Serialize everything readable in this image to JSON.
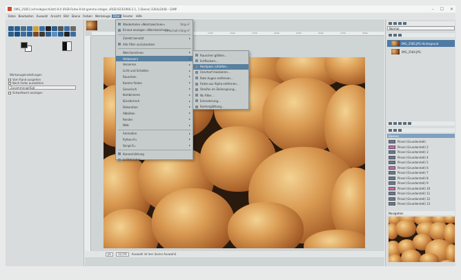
{
  "window": {
    "title": "[IMG_2585] (schreibgeschützt)-8.0 (RGB-Farbe 8 bit gamma integer, sRGB IEC61966-2.1, 1 Ebene) 3264x2448 – GIMP",
    "controls": [
      "–",
      "☐",
      "✕"
    ]
  },
  "menubar": {
    "items": [
      "Datei",
      "Bearbeiten",
      "Auswahl",
      "Ansicht",
      "Bild",
      "Ebene",
      "Farben",
      "Werkzeuge",
      "Filter",
      "Fenster",
      "Hilfe"
    ],
    "active_index": 8
  },
  "toolbox": {
    "colors": {
      "fg": "#1a1a1a",
      "bg": "#ffffff"
    },
    "options_title": "Werkzeugeinstellungen",
    "options": [
      {
        "label": "Vom Rand ausgehen",
        "checked": false
      },
      {
        "label": "Nach Farbe auswählen",
        "checked": false
      }
    ],
    "select_value": "Zusammengefügt",
    "option_last": "Schwellwert anzeigen"
  },
  "ruler": {
    "ticks": [
      "250",
      "500",
      "750",
      "1000",
      "1250",
      "1500",
      "1750",
      "2000",
      "2250",
      "2500",
      "2750",
      "3000"
    ]
  },
  "filter_menu": {
    "items": [
      {
        "label": "Wiederholen »Weichzeichnen«",
        "shortcut": "Strg+F",
        "icon": "repeat-icon"
      },
      {
        "label": "Erneut anzeigen »Weichzeichnen«",
        "shortcut": "Umschalt+Strg+F",
        "icon": "reshow-icon"
      },
      {
        "label": "Zuletzt benutzt",
        "arrow": true
      },
      {
        "label": "Alle Filter zurücksetzen",
        "icon": "reset-icon"
      },
      {
        "label": "Weichzeichnen",
        "arrow": true
      },
      {
        "label": "Verbessern",
        "arrow": true,
        "highlight": true
      },
      {
        "label": "Verzerren",
        "arrow": true
      },
      {
        "label": "Licht und Schatten",
        "arrow": true
      },
      {
        "label": "Rauschen",
        "arrow": true
      },
      {
        "label": "Kanten finden",
        "arrow": true
      },
      {
        "label": "Generisch",
        "arrow": true
      },
      {
        "label": "Kombinieren",
        "arrow": true
      },
      {
        "label": "Künstlerisch",
        "arrow": true
      },
      {
        "label": "Dekoration",
        "arrow": true
      },
      {
        "label": "Abbilden",
        "arrow": true
      },
      {
        "label": "Render",
        "arrow": true
      },
      {
        "label": "Web",
        "arrow": true
      },
      {
        "label": "Animation",
        "arrow": true
      },
      {
        "label": "Python-Fu",
        "arrow": true
      },
      {
        "label": "Skript-Fu",
        "arrow": true
      },
      {
        "label": "Kaneschildrung",
        "icon": "script-icon"
      },
      {
        "label": "Lichtmischer",
        "icon": "mixer-icon"
      }
    ]
  },
  "submenu": {
    "items": [
      {
        "label": "Rauschen glätten...",
        "icon": "denoise-icon"
      },
      {
        "label": "Entflackern...",
        "icon": "deflicker-icon"
      },
      {
        "label": "Hochpass schärfen...",
        "icon": "sharpen-icon",
        "highlight": true
      },
      {
        "label": "Unscharf maskieren...",
        "icon": "unsharp-icon"
      },
      {
        "label": "Rote Augen entfernen...",
        "icon": "redeye-icon"
      },
      {
        "label": "Farbe aus Alpha entfernen...",
        "icon": "alpha-icon"
      },
      {
        "label": "Streifen im Zeilensprung...",
        "icon": "stripe-icon"
      },
      {
        "label": "NL-Filter...",
        "icon": "nl-icon"
      },
      {
        "label": "Entrasterung...",
        "icon": "descreen-icon"
      },
      {
        "label": "Kantenglättung...",
        "icon": "antialias-icon"
      }
    ]
  },
  "statusbar": {
    "unit": "px",
    "zoom": "12,5%",
    "message": "Auswahl ist leer (keine Auswahl)"
  },
  "dock": {
    "mode_label": "Normal",
    "layers": [
      {
        "name": "IMG_2585.JPG Hintergrund",
        "selected": true
      },
      {
        "name": "IMG_2584.JPG",
        "selected": false
      }
    ],
    "brush_section_label": "Ebenen",
    "brushes": [
      "Pinsel (Grunderstell)",
      "Pinsel (Grunderstell) 2",
      "Pinsel (Grunderstell) 3",
      "Pinsel (Grunderstell) 4",
      "Pinsel (Grunderstell) 5",
      "Pinsel (Grunderstell) 6",
      "Pinsel (Grunderstell) 7",
      "Pinsel (Grunderstell) 8",
      "Pinsel (Grunderstell) 9",
      "Pinsel (Grunderstell) 10",
      "Pinsel (Grunderstell) 11",
      "Pinsel (Grunderstell) 12",
      "Pinsel (Grunderstell) 13"
    ],
    "navigation_label": "Navigation"
  }
}
